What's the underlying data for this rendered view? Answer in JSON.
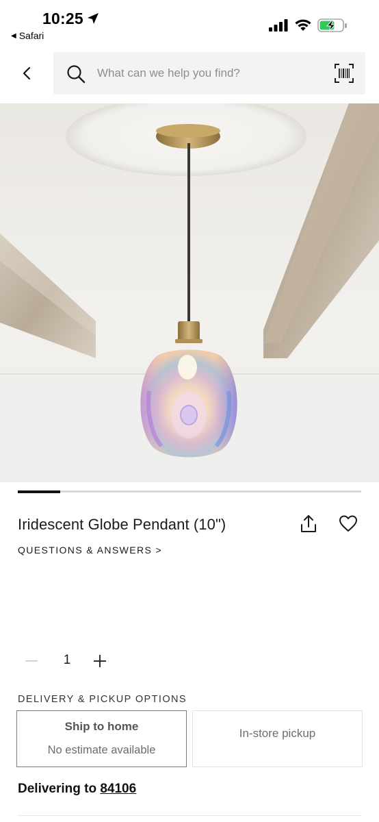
{
  "status_bar": {
    "time": "10:25",
    "back_app": "Safari",
    "back_arrow_glyph": "◀"
  },
  "nav": {
    "back_icon": "chevron-left-icon",
    "search_placeholder": "What can we help you find?",
    "search_value": "",
    "scan_icon": "barcode-scan-icon"
  },
  "product": {
    "image_alt": "Iridescent Globe Pendant (10\")",
    "carousel": {
      "active_index": 0,
      "total": 6
    },
    "title": "Iridescent Globe Pendant (10\")",
    "share_icon": "share-icon",
    "favorite_icon": "heart-icon",
    "qa_link": "QUESTIONS & ANSWERS >"
  },
  "quantity": {
    "value": "1",
    "minus_glyph": "—",
    "plus_glyph": "+"
  },
  "delivery": {
    "heading": "DELIVERY & PICKUP OPTIONS",
    "options": [
      {
        "title": "Ship to home",
        "subtitle": "No estimate available",
        "selected": true
      },
      {
        "title": "In-store pickup",
        "subtitle": "",
        "selected": false
      }
    ],
    "delivering_label": "Delivering to",
    "zip": "84106"
  },
  "colors": {
    "text": "#1a1a1a",
    "search_bg": "#f3f3f3",
    "selected_border": "#7a7a7a",
    "muted": "#6d6d6d"
  }
}
